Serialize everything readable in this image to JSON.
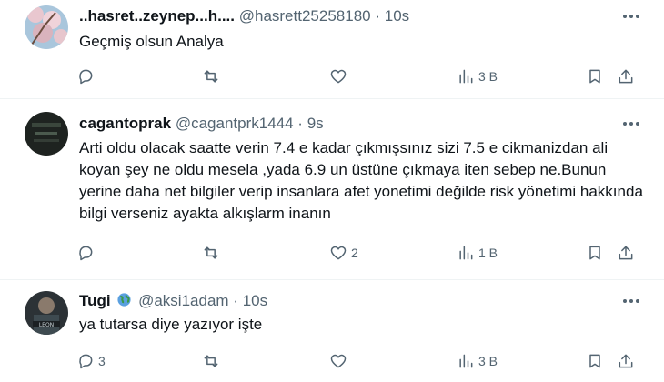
{
  "tweets": [
    {
      "name": "..hasret..zeynep...h....",
      "handle": "@hasrett25258180",
      "separator": "·",
      "time": "10s",
      "text": "Geçmiş olsun Analya",
      "replies": "",
      "retweets": "",
      "likes": "",
      "views": "3 B",
      "avatar_icon": "cherry-blossom-avatar"
    },
    {
      "name": "cagantoprak",
      "handle": "@cagantprk1444",
      "separator": "·",
      "time": "9s",
      "text": "Arti oldu olacak saatte verin 7.4 e kadar çıkmışsınız sizi 7.5 e cikmanizdan ali koyan şey ne oldu mesela ,yada 6.9 un üstüne çıkmaya iten sebep ne.Bunun yerine daha net bilgiler verip insanlara afet yonetimi değilde risk yönetimi hakkında bilgi verseniz ayakta alkışlarm inanın",
      "replies": "",
      "retweets": "",
      "likes": "2",
      "views": "1 B",
      "avatar_icon": "dark-avatar"
    },
    {
      "name": "Tugi",
      "badge_icon": "globe-emoji-icon",
      "handle": "@aksi1adam",
      "separator": "·",
      "time": "10s",
      "text": "ya tutarsa diye yazıyor işte",
      "replies": "3",
      "retweets": "",
      "likes": "",
      "views": "3 B",
      "avatar_icon": "leon-avatar"
    }
  ],
  "colors": {
    "text": "#0f1419",
    "secondary": "#536471",
    "divider": "#eff3f4"
  }
}
